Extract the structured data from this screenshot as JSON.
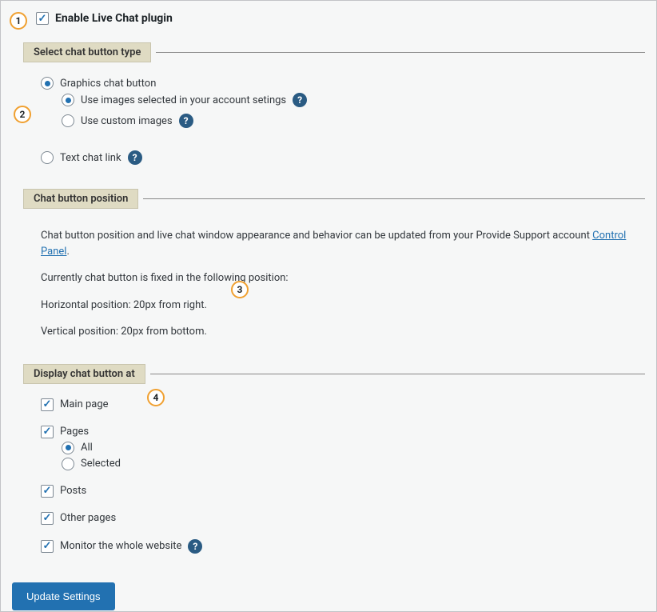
{
  "enable": {
    "label": "Enable Live Chat plugin",
    "checked": true
  },
  "section1": {
    "legend": "Select chat button type",
    "opt_graphics": "Graphics chat button",
    "opt_images_account": "Use images selected in your account setings",
    "opt_custom_images": "Use custom images",
    "opt_text_link": "Text chat link"
  },
  "section2": {
    "legend": "Chat button position",
    "desc_pre": "Chat button position and live chat window appearance and behavior can be updated from your Provide Support account ",
    "link": "Control Panel",
    "desc_post": ".",
    "current": "Currently chat button is fixed in the following position:",
    "horiz": "Horizontal position: 20px from right.",
    "vert": "Vertical position: 20px from bottom."
  },
  "section3": {
    "legend": "Display chat button at",
    "main_page": "Main page",
    "pages": "Pages",
    "pages_all": "All",
    "pages_selected": "Selected",
    "posts": "Posts",
    "other_pages": "Other pages",
    "monitor": "Monitor the whole website"
  },
  "button": {
    "update": "Update Settings"
  },
  "annotations": {
    "a1": "1",
    "a2": "2",
    "a3": "3",
    "a4": "4"
  }
}
